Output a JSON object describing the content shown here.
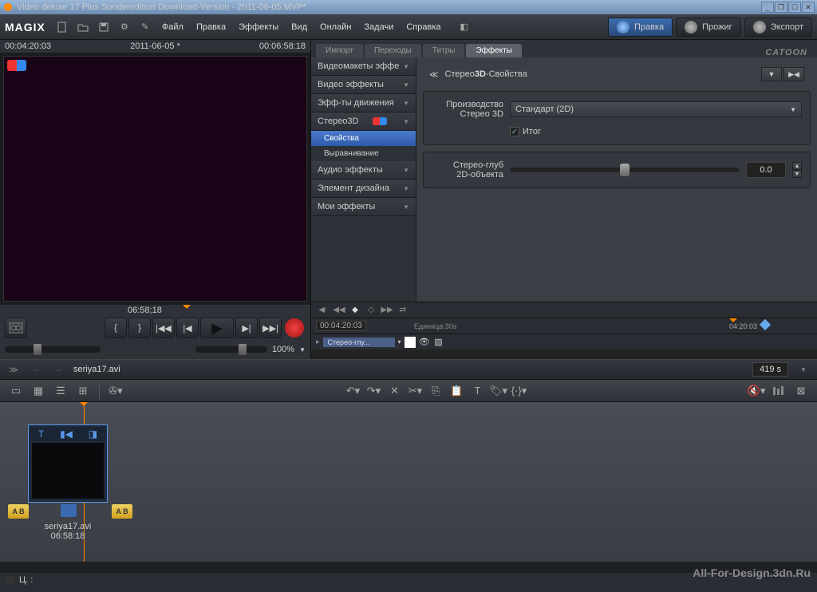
{
  "title": "Video deluxe 17 Plus Sonderedition Download-Version - 2011-06-05.MVP*",
  "logo": "MAGIX",
  "menu": {
    "file": "Файл",
    "edit": "Правка",
    "effects": "Эффекты",
    "view": "Вид",
    "online": "Онлайн",
    "tasks": "Задачи",
    "help": "Справка"
  },
  "actions": {
    "edit": "Правка",
    "burn": "Прожиг",
    "export": "Экспорт"
  },
  "preview": {
    "tc_left": "00:04:20:03",
    "tc_mid": "2011-06-05 *",
    "tc_right": "00:06:58:18",
    "ruler": "06:58;18",
    "zoom": "100%"
  },
  "tabs": {
    "import": "Импорт",
    "trans": "Переходы",
    "titles": "Титры",
    "fx": "Эффекты"
  },
  "catoon": "CATOON",
  "fxtree": {
    "cat1": "Видеомакеты эффе",
    "cat2": "Видео эффекты",
    "cat3": "Эфф-ты движения",
    "cat4": "Стерео3D",
    "sub1": "Свойства",
    "sub2": "Выравнивание",
    "cat5": "Аудио эффекты",
    "cat6": "Элемент дизайна",
    "cat7": "Мои эффекты"
  },
  "fxpanel": {
    "title_pre": "Стерео",
    "title_b": "3D",
    "title_post": "-Свойства",
    "prod_lbl1": "Производство",
    "prod_lbl2": "Стерео 3D",
    "prod_val": "Стандарт (2D)",
    "chk": "Итог",
    "depth_lbl1": "Стерео-глуб",
    "depth_lbl2": "2D-объекта",
    "depth_val": "0.0"
  },
  "kf": {
    "time": "00:04:20:03",
    "unit": "Единица:30s",
    "track": "Стерео-глу...",
    "marktime": "04:20:03"
  },
  "file": {
    "name": "seriya17.avi",
    "dur": "419 s"
  },
  "clip": {
    "name": "seriya17.avi",
    "dur": "06:58:18"
  },
  "ab": {
    "a": "A B",
    "b": "A B"
  },
  "status": "Ц. :",
  "watermark": "All-For-Design.3dn.Ru"
}
